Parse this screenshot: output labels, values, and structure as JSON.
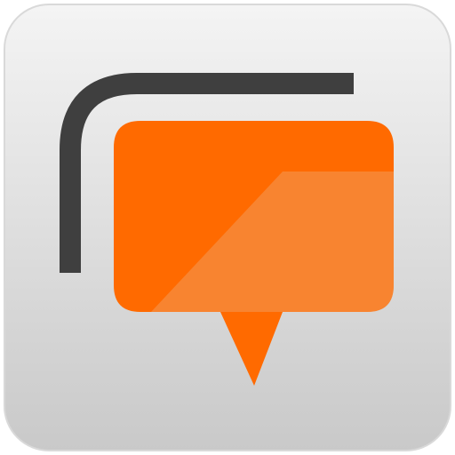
{
  "app_icon": {
    "icon_name": "stacked-chat-bubbles-icon",
    "colors": {
      "tile_gradient_top": "#f4f4f4",
      "tile_gradient_bottom": "#c9c9c9",
      "tile_border": "#d9d9d9",
      "back_bubble_stroke": "#3f3f3f",
      "front_bubble_orange": "#ff6a00",
      "front_bubble_highlight": "#f0a36b"
    }
  }
}
